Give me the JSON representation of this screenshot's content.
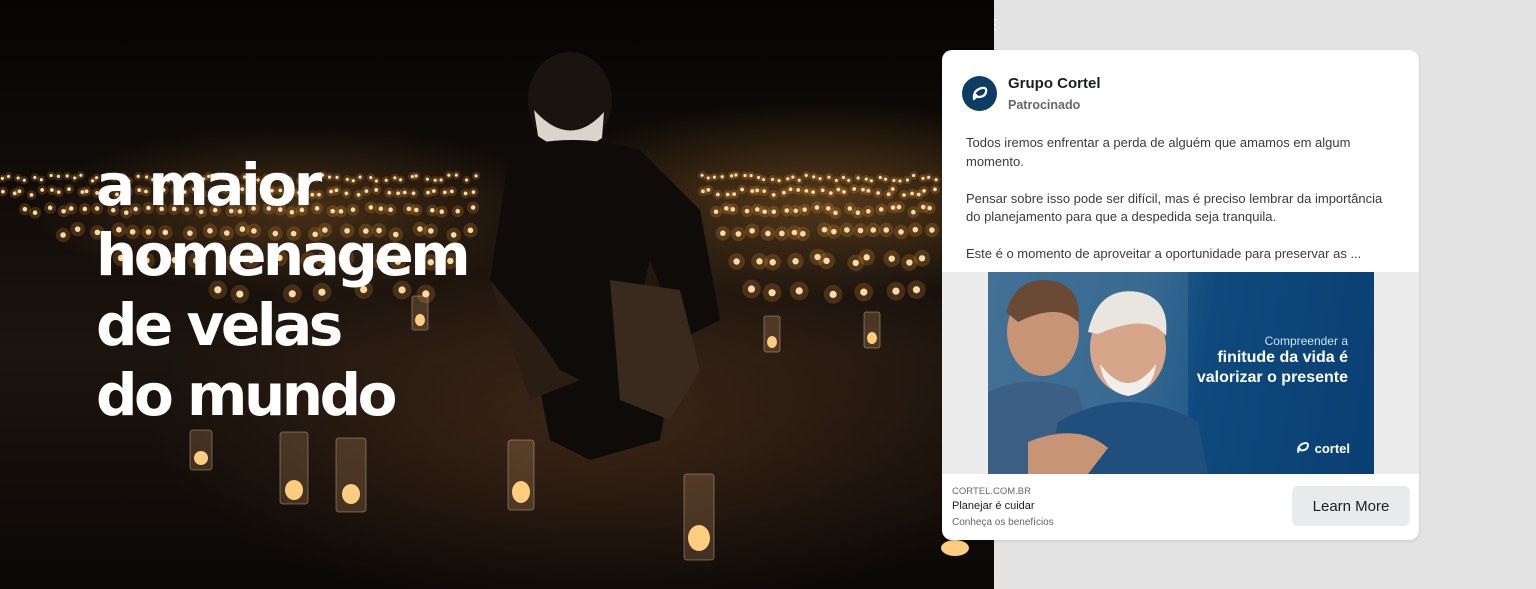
{
  "hero": {
    "headline_lines": [
      "a maior",
      "homenagem",
      "de velas",
      "do mundo"
    ]
  },
  "ad": {
    "page_name": "Grupo Cortel",
    "sponsored_label": "Patrocinado",
    "paragraphs": [
      "Todos iremos enfrentar a perda de alguém que amamos em algum momento.",
      "Pensar sobre isso pode ser difícil, mas é preciso lembrar da importância do planejamento para que a despedida seja tranquila.",
      "Este é o momento de aproveitar a oportunidade para preservar as ..."
    ],
    "creative": {
      "line1": "Compreender a",
      "line2": "finitude da vida é",
      "line3": "valorizar o presente",
      "brand": "cortel"
    },
    "footer": {
      "domain": "CORTEL.COM.BR",
      "headline": "Planejar é cuidar",
      "description": "Conheça os benefícios",
      "cta_label": "Learn More"
    }
  },
  "colors": {
    "brand_navy": "#0d3d63",
    "background": "#e3e3e3",
    "cta_bg": "#e9eaeb"
  }
}
